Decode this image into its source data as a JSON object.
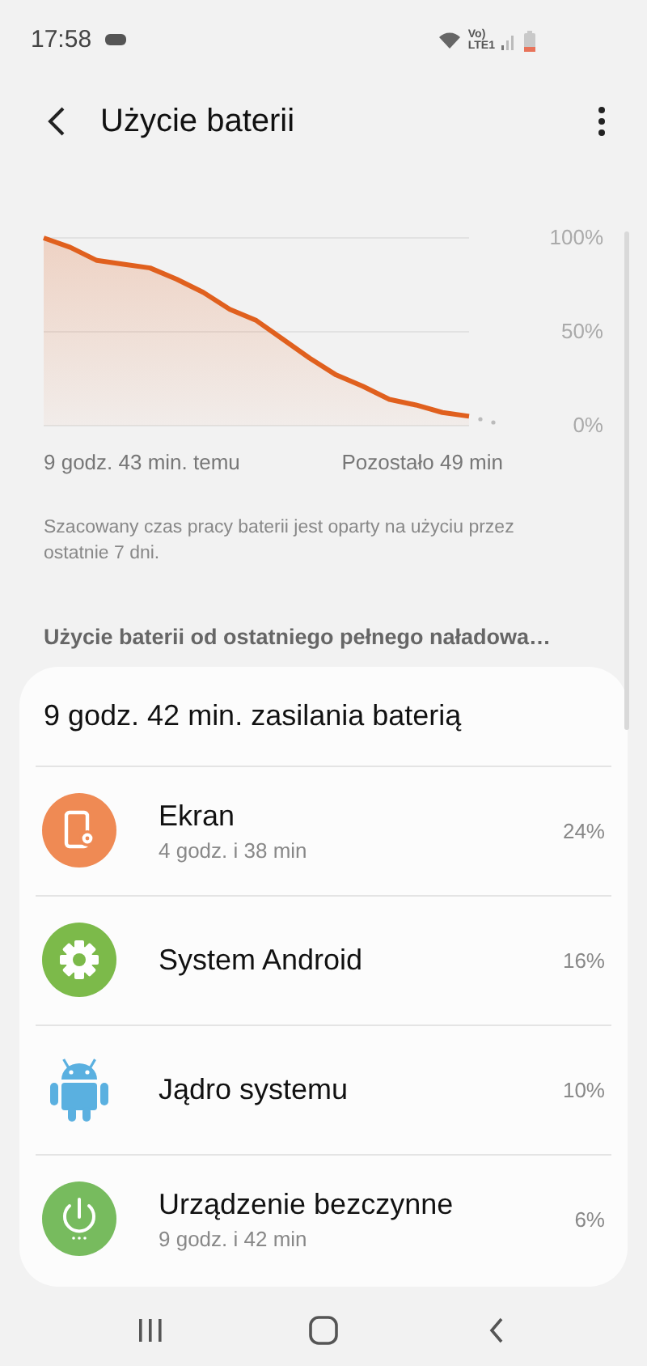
{
  "status_bar": {
    "time": "17:58",
    "network_label": "Vo)\nLTE1"
  },
  "header": {
    "title": "Użycie baterii"
  },
  "chart_data": {
    "type": "area",
    "ylim": [
      0,
      100
    ],
    "yticks": [
      {
        "value": 0,
        "label": "0%"
      },
      {
        "value": 50,
        "label": "50%"
      },
      {
        "value": 100,
        "label": "100%"
      }
    ],
    "series": [
      {
        "color": "#e0601e",
        "values": [
          100,
          95,
          88,
          86,
          84,
          78,
          71,
          62,
          56,
          46,
          36,
          27,
          21,
          14,
          11,
          7,
          5
        ]
      }
    ]
  },
  "chart_labels": {
    "start": "9 godz. 43 min. temu",
    "end": "Pozostało 49 min"
  },
  "note": "Szacowany czas pracy baterii jest oparty na użyciu przez ostatnie 7 dni.",
  "section_title": "Użycie baterii od ostatniego pełnego naładowa…",
  "card": {
    "title": "9 godz. 42 min. zasilania baterią",
    "items": [
      {
        "kind": "screen",
        "name": "Ekran",
        "detail": "4 godz. i 38 min",
        "percent": "24%"
      },
      {
        "kind": "system",
        "name": "System Android",
        "percent": "16%"
      },
      {
        "kind": "android",
        "name": "Jądro systemu",
        "percent": "10%"
      },
      {
        "kind": "idle",
        "name": "Urządzenie bezczynne",
        "detail": "9 godz. i 42 min",
        "percent": "6%"
      }
    ]
  }
}
